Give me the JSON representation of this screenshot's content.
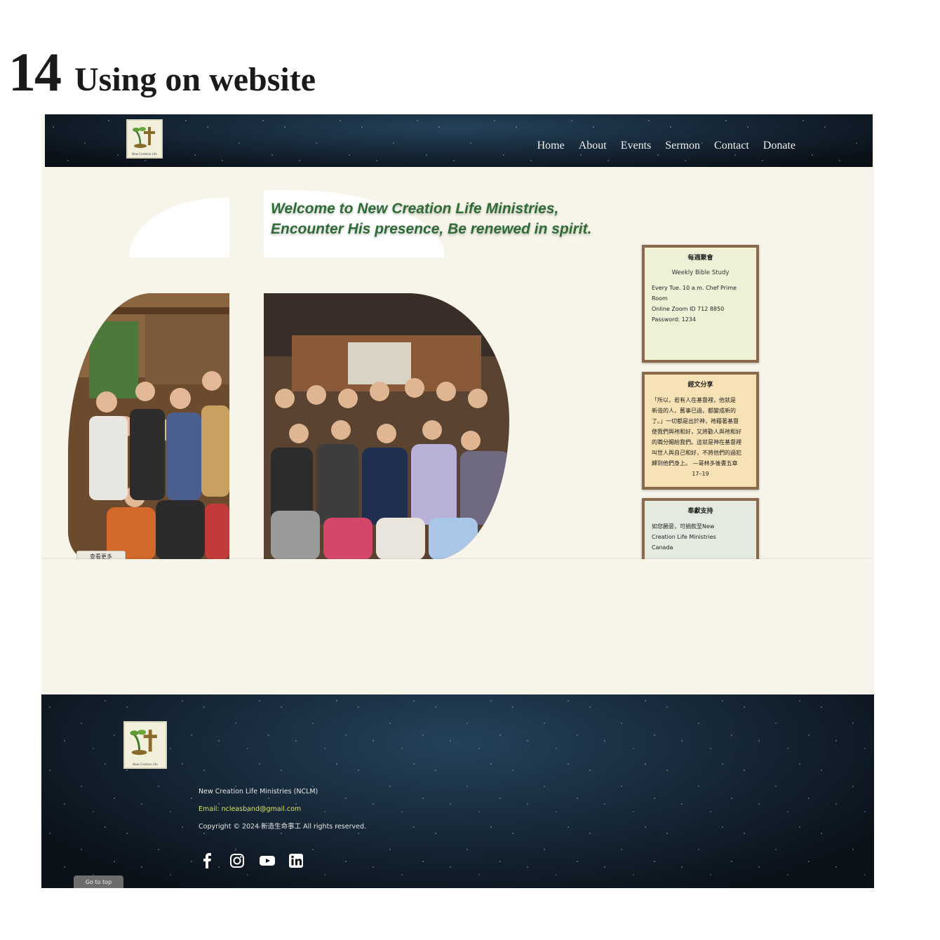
{
  "slide": {
    "number": "14",
    "title": "Using on website"
  },
  "header": {
    "logo_caption": "New Creation Life",
    "nav": [
      "Home",
      "About",
      "Events",
      "Sermon",
      "Contact",
      "Donate"
    ]
  },
  "hero": {
    "welcome_line1": "Welcome to New Creation Life Ministries,",
    "welcome_line2": "Encounter His presence, Be renewed in spirit.",
    "photo_badge": "查看更多"
  },
  "cards": [
    {
      "title": "每週聚會",
      "subtitle": "Weekly Bible Study",
      "lines": [
        "Every Tue. 10 a.m. Chef Prime",
        "Room",
        "Online Zoom ID 712 8850",
        "Password: 1234"
      ]
    },
    {
      "title": "經文分享",
      "lines": [
        "「所以，若有人在基督裡，他就是",
        "新造的人，舊事已過，都變成新的",
        "了。」一切都是出於神，祂藉著基督",
        "使我們與祂和好，又將勸人與祂和好",
        "的職分賜給我們。這就是神在基督裡",
        "叫世人與自己和好，不將他們的過犯",
        "歸到他們身上。 —哥林多後書五章",
        "17–19"
      ]
    },
    {
      "title": "奉獻支持",
      "lines": [
        "如您願意，可捐款至New",
        "Creation Life Ministries",
        "Canada"
      ]
    }
  ],
  "footer": {
    "org_name": "New Creation Life Ministries (NCLM)",
    "email": "Email: ncleasband@gmail.com",
    "copyright": "Copyright © 2024 新造生命事工 All rights reserved.",
    "badge": "Go to top"
  },
  "icons": [
    "facebook-icon",
    "instagram-icon",
    "youtube-icon",
    "linkedin-icon"
  ],
  "colors": {
    "accent_green": "#2e6b35",
    "email_yellow": "#d6e36a",
    "frame_wood": "#8a6a4a",
    "page_cream": "#f7f5ea"
  }
}
